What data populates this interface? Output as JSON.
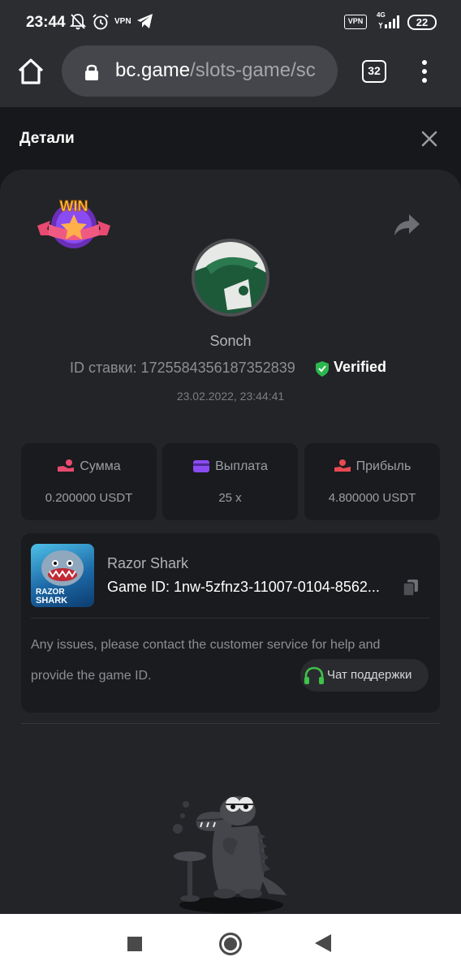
{
  "status_bar": {
    "time": "23:44",
    "vpn_label": "VPN",
    "vpn_box": "VPN",
    "network": "4G",
    "battery": "22"
  },
  "browser": {
    "url_host": "bc.game",
    "url_path": "/slots-game/sc",
    "tab_count": "32"
  },
  "details": {
    "title": "Детали"
  },
  "bet": {
    "username": "Sonch",
    "bet_id_label": "ID ставки: 1725584356187352839",
    "verified_label": "Verified",
    "datetime": "23.02.2022, 23:44:41"
  },
  "stats": [
    {
      "label": "Сумма",
      "value": "0.200000 USDT",
      "icon": "coin-hand-icon"
    },
    {
      "label": "Выплата",
      "value": "25 x",
      "icon": "wallet-icon"
    },
    {
      "label": "Прибыль",
      "value": "4.800000 USDT",
      "icon": "profit-hand-icon"
    }
  ],
  "game": {
    "name": "Razor Shark",
    "id_text": "Game ID: 1nw-5zfnz3-11007-0104-8562...",
    "thumb_line1": "RAZOR",
    "thumb_line2": "SHARK",
    "issues_text": "Any issues, please contact the customer service for help and provide the game ID.",
    "support_label": "Чат поддержки"
  },
  "badge": {
    "text": "WIN"
  },
  "colors": {
    "background": "#17181b",
    "panel": "#232427",
    "card": "#1a1b1e",
    "verified_green": "#2bb84d",
    "support_green": "#3fc14a",
    "accent_pink": "#e84a72",
    "accent_purple": "#8a4bf2"
  }
}
